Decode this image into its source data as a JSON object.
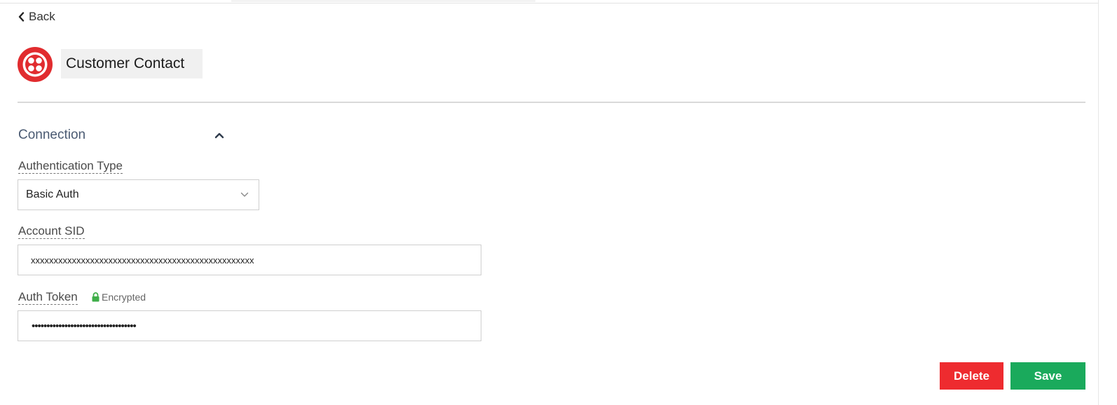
{
  "nav": {
    "back_label": "Back"
  },
  "header": {
    "title": "Customer Contact",
    "logo_icon": "twilio-logo-icon",
    "logo_color": "#e12c2f"
  },
  "connection": {
    "section_title": "Connection",
    "collapse_icon": "chevron-up-icon",
    "auth_type": {
      "label": "Authentication Type",
      "value": "Basic Auth",
      "dropdown_icon": "chevron-down-icon"
    },
    "account_sid": {
      "label": "Account SID",
      "value": "xxxxxxxxxxxxxxxxxxxxxxxxxxxxxxxxxxxxxxxxxxxxxxxxx"
    },
    "auth_token": {
      "label": "Auth Token",
      "badge": "Encrypted",
      "badge_icon": "lock-icon",
      "badge_color": "#3fae49",
      "value": "•••••••••••••••••••••••••••••••••••"
    }
  },
  "actions": {
    "delete_label": "Delete",
    "delete_color": "#ee2b2f",
    "save_label": "Save",
    "save_color": "#1aaa5c"
  }
}
